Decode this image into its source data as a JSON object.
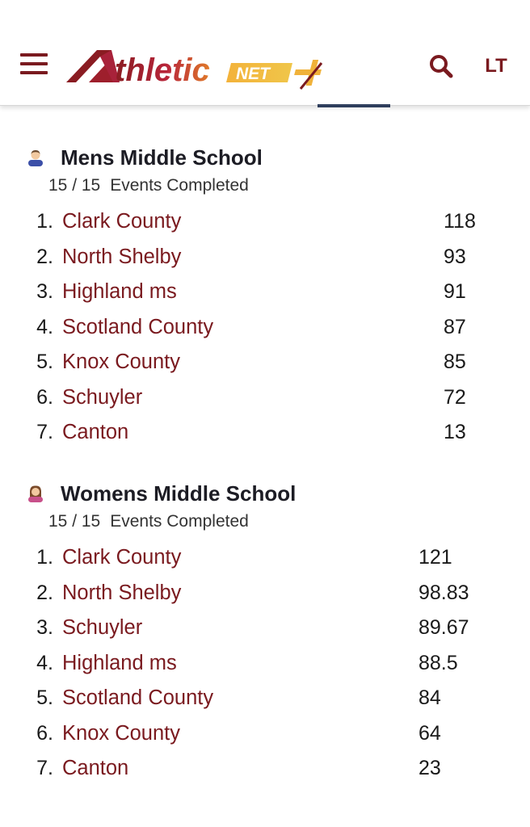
{
  "header": {
    "user_initials": "LT",
    "colors": {
      "brand_maroon": "#7a1a1f",
      "brand_gold": "#f0b23a",
      "tab_indicator": "#2f3e5c"
    },
    "icons": {
      "menu": "hamburger-icon",
      "search": "search-icon",
      "logo": "athletic-net-logo"
    }
  },
  "divisions": [
    {
      "icon": "male-person-icon",
      "title": "Mens Middle School",
      "events_done": "15 / 15",
      "events_label": "Events Completed",
      "teams": [
        {
          "rank": "1.",
          "name": "Clark County",
          "score": "118"
        },
        {
          "rank": "2.",
          "name": "North Shelby",
          "score": "93"
        },
        {
          "rank": "3.",
          "name": "Highland ms",
          "score": "91"
        },
        {
          "rank": "4.",
          "name": "Scotland County",
          "score": "87"
        },
        {
          "rank": "5.",
          "name": "Knox County",
          "score": "85"
        },
        {
          "rank": "6.",
          "name": "Schuyler",
          "score": "72"
        },
        {
          "rank": "7.",
          "name": "Canton",
          "score": "13"
        }
      ]
    },
    {
      "icon": "female-person-icon",
      "title": "Womens Middle School",
      "events_done": "15 / 15",
      "events_label": "Events Completed",
      "teams": [
        {
          "rank": "1.",
          "name": "Clark County",
          "score": "121"
        },
        {
          "rank": "2.",
          "name": "North Shelby",
          "score": "98.83"
        },
        {
          "rank": "3.",
          "name": "Schuyler",
          "score": "89.67"
        },
        {
          "rank": "4.",
          "name": "Highland ms",
          "score": "88.5"
        },
        {
          "rank": "5.",
          "name": "Scotland County",
          "score": "84"
        },
        {
          "rank": "6.",
          "name": "Knox County",
          "score": "64"
        },
        {
          "rank": "7.",
          "name": "Canton",
          "score": "23"
        }
      ]
    }
  ]
}
